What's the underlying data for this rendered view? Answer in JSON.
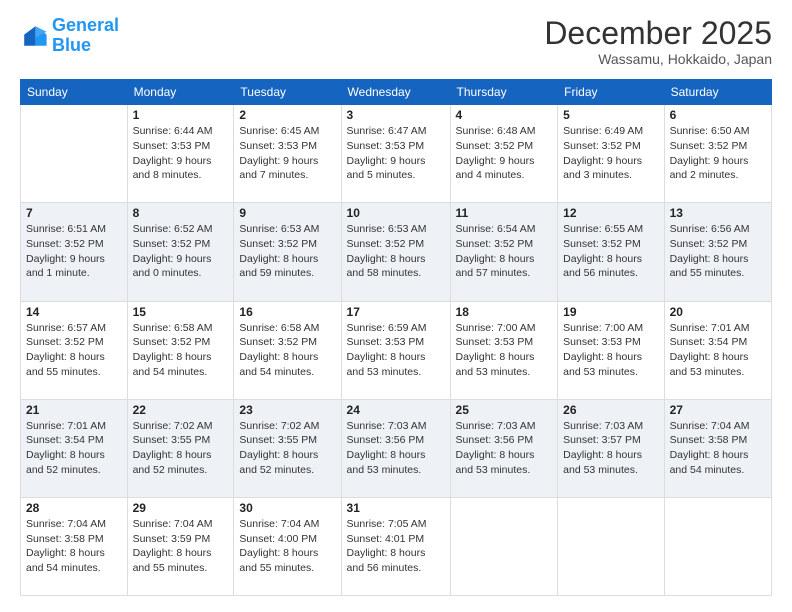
{
  "logo": {
    "line1": "General",
    "line2": "Blue"
  },
  "header": {
    "title": "December 2025",
    "location": "Wassamu, Hokkaido, Japan"
  },
  "weekdays": [
    "Sunday",
    "Monday",
    "Tuesday",
    "Wednesday",
    "Thursday",
    "Friday",
    "Saturday"
  ],
  "weeks": [
    [
      {
        "day": "",
        "info": ""
      },
      {
        "day": "1",
        "info": "Sunrise: 6:44 AM\nSunset: 3:53 PM\nDaylight: 9 hours\nand 8 minutes."
      },
      {
        "day": "2",
        "info": "Sunrise: 6:45 AM\nSunset: 3:53 PM\nDaylight: 9 hours\nand 7 minutes."
      },
      {
        "day": "3",
        "info": "Sunrise: 6:47 AM\nSunset: 3:53 PM\nDaylight: 9 hours\nand 5 minutes."
      },
      {
        "day": "4",
        "info": "Sunrise: 6:48 AM\nSunset: 3:52 PM\nDaylight: 9 hours\nand 4 minutes."
      },
      {
        "day": "5",
        "info": "Sunrise: 6:49 AM\nSunset: 3:52 PM\nDaylight: 9 hours\nand 3 minutes."
      },
      {
        "day": "6",
        "info": "Sunrise: 6:50 AM\nSunset: 3:52 PM\nDaylight: 9 hours\nand 2 minutes."
      }
    ],
    [
      {
        "day": "7",
        "info": "Sunrise: 6:51 AM\nSunset: 3:52 PM\nDaylight: 9 hours\nand 1 minute."
      },
      {
        "day": "8",
        "info": "Sunrise: 6:52 AM\nSunset: 3:52 PM\nDaylight: 9 hours\nand 0 minutes."
      },
      {
        "day": "9",
        "info": "Sunrise: 6:53 AM\nSunset: 3:52 PM\nDaylight: 8 hours\nand 59 minutes."
      },
      {
        "day": "10",
        "info": "Sunrise: 6:53 AM\nSunset: 3:52 PM\nDaylight: 8 hours\nand 58 minutes."
      },
      {
        "day": "11",
        "info": "Sunrise: 6:54 AM\nSunset: 3:52 PM\nDaylight: 8 hours\nand 57 minutes."
      },
      {
        "day": "12",
        "info": "Sunrise: 6:55 AM\nSunset: 3:52 PM\nDaylight: 8 hours\nand 56 minutes."
      },
      {
        "day": "13",
        "info": "Sunrise: 6:56 AM\nSunset: 3:52 PM\nDaylight: 8 hours\nand 55 minutes."
      }
    ],
    [
      {
        "day": "14",
        "info": "Sunrise: 6:57 AM\nSunset: 3:52 PM\nDaylight: 8 hours\nand 55 minutes."
      },
      {
        "day": "15",
        "info": "Sunrise: 6:58 AM\nSunset: 3:52 PM\nDaylight: 8 hours\nand 54 minutes."
      },
      {
        "day": "16",
        "info": "Sunrise: 6:58 AM\nSunset: 3:52 PM\nDaylight: 8 hours\nand 54 minutes."
      },
      {
        "day": "17",
        "info": "Sunrise: 6:59 AM\nSunset: 3:53 PM\nDaylight: 8 hours\nand 53 minutes."
      },
      {
        "day": "18",
        "info": "Sunrise: 7:00 AM\nSunset: 3:53 PM\nDaylight: 8 hours\nand 53 minutes."
      },
      {
        "day": "19",
        "info": "Sunrise: 7:00 AM\nSunset: 3:53 PM\nDaylight: 8 hours\nand 53 minutes."
      },
      {
        "day": "20",
        "info": "Sunrise: 7:01 AM\nSunset: 3:54 PM\nDaylight: 8 hours\nand 53 minutes."
      }
    ],
    [
      {
        "day": "21",
        "info": "Sunrise: 7:01 AM\nSunset: 3:54 PM\nDaylight: 8 hours\nand 52 minutes."
      },
      {
        "day": "22",
        "info": "Sunrise: 7:02 AM\nSunset: 3:55 PM\nDaylight: 8 hours\nand 52 minutes."
      },
      {
        "day": "23",
        "info": "Sunrise: 7:02 AM\nSunset: 3:55 PM\nDaylight: 8 hours\nand 52 minutes."
      },
      {
        "day": "24",
        "info": "Sunrise: 7:03 AM\nSunset: 3:56 PM\nDaylight: 8 hours\nand 53 minutes."
      },
      {
        "day": "25",
        "info": "Sunrise: 7:03 AM\nSunset: 3:56 PM\nDaylight: 8 hours\nand 53 minutes."
      },
      {
        "day": "26",
        "info": "Sunrise: 7:03 AM\nSunset: 3:57 PM\nDaylight: 8 hours\nand 53 minutes."
      },
      {
        "day": "27",
        "info": "Sunrise: 7:04 AM\nSunset: 3:58 PM\nDaylight: 8 hours\nand 54 minutes."
      }
    ],
    [
      {
        "day": "28",
        "info": "Sunrise: 7:04 AM\nSunset: 3:58 PM\nDaylight: 8 hours\nand 54 minutes."
      },
      {
        "day": "29",
        "info": "Sunrise: 7:04 AM\nSunset: 3:59 PM\nDaylight: 8 hours\nand 55 minutes."
      },
      {
        "day": "30",
        "info": "Sunrise: 7:04 AM\nSunset: 4:00 PM\nDaylight: 8 hours\nand 55 minutes."
      },
      {
        "day": "31",
        "info": "Sunrise: 7:05 AM\nSunset: 4:01 PM\nDaylight: 8 hours\nand 56 minutes."
      },
      {
        "day": "",
        "info": ""
      },
      {
        "day": "",
        "info": ""
      },
      {
        "day": "",
        "info": ""
      }
    ]
  ]
}
